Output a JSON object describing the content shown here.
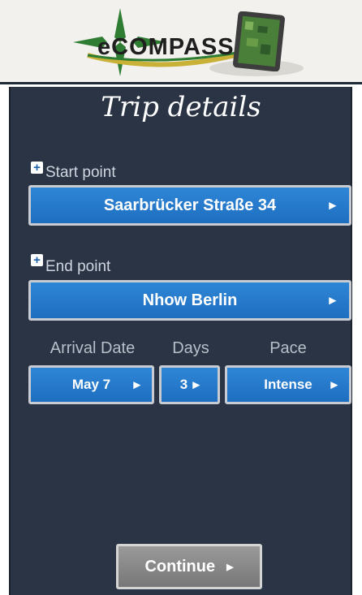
{
  "app": {
    "logo_text": "eCOMPASS"
  },
  "page": {
    "title": "Trip details"
  },
  "form": {
    "start_label": "Start point",
    "start_value": "Saarbrücker Straße 34",
    "end_label": "End point",
    "end_value": "Nhow Berlin",
    "arrival_label": "Arrival Date",
    "arrival_value": "May 7",
    "days_label": "Days",
    "days_value": "3",
    "pace_label": "Pace",
    "pace_value": "Intense"
  },
  "actions": {
    "continue_label": "Continue"
  },
  "icons": {
    "plus": "plus-icon",
    "arrow": "chevron-right-icon",
    "compass": "compass-icon",
    "tablet": "tablet-icon"
  },
  "colors": {
    "panel_bg": "#2a3444",
    "button_blue": "#2577c8",
    "continue_gray": "#8a8a8a"
  }
}
